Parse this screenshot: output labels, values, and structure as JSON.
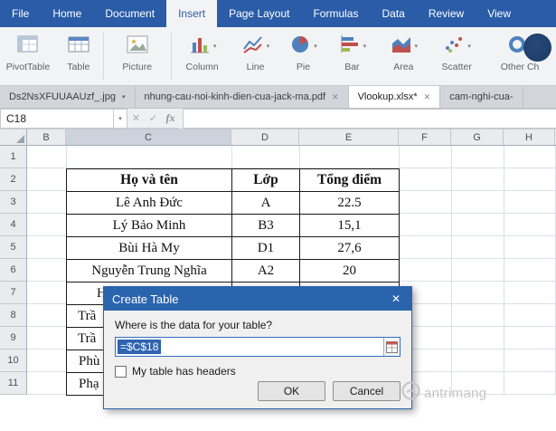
{
  "menu": {
    "tabs": [
      "File",
      "Home",
      "Document",
      "Insert",
      "Page Layout",
      "Formulas",
      "Data",
      "Review",
      "View"
    ],
    "active_tab": "Insert"
  },
  "ribbon": {
    "pivottable": "PivotTable",
    "table": "Table",
    "picture": "Picture",
    "column": "Column",
    "line": "Line",
    "pie": "Pie",
    "bar": "Bar",
    "area": "Area",
    "scatter": "Scatter",
    "other": "Other Ch"
  },
  "doc_tabs": [
    "Ds2NsXFUUAAUzf_.jpg",
    "nhung-cau-noi-kinh-dien-cua-jack-ma.pdf",
    "Vlookup.xlsx*",
    "cam-nghi-cua-"
  ],
  "formula_bar": {
    "name_box": "C18",
    "formula": ""
  },
  "icons": {
    "dropdown": "▾",
    "close": "✕",
    "enter": "✓",
    "fx": "fx"
  },
  "grid": {
    "col_headers": [
      "B",
      "C",
      "D",
      "E",
      "F",
      "G",
      "H"
    ],
    "row_headers": [
      "1",
      "2",
      "3",
      "4",
      "5",
      "6",
      "7",
      "8",
      "9",
      "10",
      "11"
    ],
    "selected_cell": "C18",
    "table": {
      "headers": [
        "Họ và tên",
        "Lớp",
        "Tổng điểm"
      ],
      "rows": [
        [
          "Lê Anh Đức",
          "A",
          "22.5"
        ],
        [
          "Lý Bảo Minh",
          "B3",
          "15,1"
        ],
        [
          "Bùi Hà My",
          "D1",
          "27,6"
        ],
        [
          "Nguyễn Trung Nghĩa",
          "A2",
          "20"
        ]
      ],
      "partial_rows": [
        "H",
        "Trầ",
        "Trầ",
        "Phù",
        "Phạ"
      ]
    }
  },
  "dialog": {
    "title": "Create Table",
    "prompt": "Where is the data for your table?",
    "range_value": "=$C$18",
    "headers_checkbox": "My table has headers",
    "checkbox_checked": false,
    "ok": "OK",
    "cancel": "Cancel"
  },
  "watermark": {
    "text": "antrimang"
  }
}
